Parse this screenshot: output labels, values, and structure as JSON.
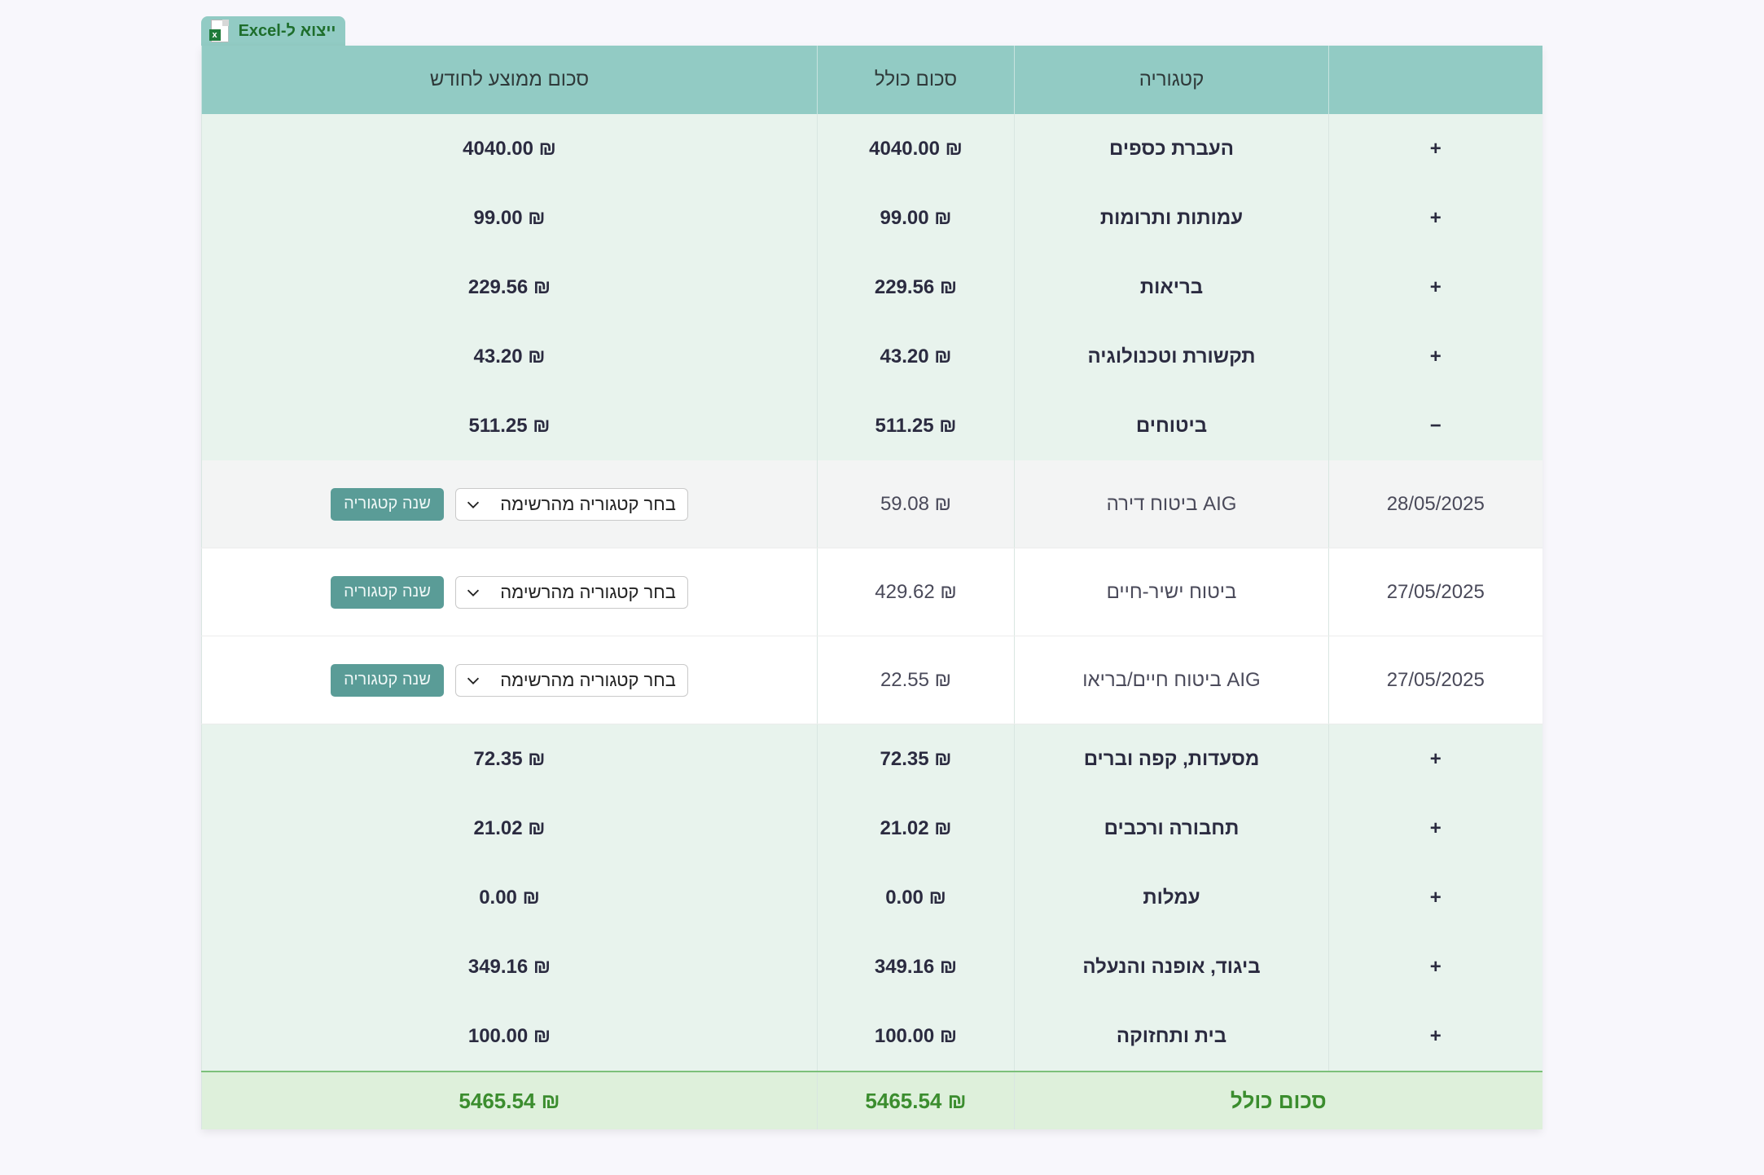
{
  "export": {
    "label": "ייצוא ל-Excel",
    "icon": "excel-file-icon"
  },
  "headers": {
    "expand": "",
    "category": "קטגוריה",
    "total": "סכום כולל",
    "average": "סכום ממוצע לחודש"
  },
  "rows": [
    {
      "type": "category",
      "toggle": "+",
      "category": "העברת כספים",
      "total": "₪ 4040.00",
      "average": "₪ 4040.00"
    },
    {
      "type": "category",
      "toggle": "+",
      "category": "עמותות ותרומות",
      "total": "₪ 99.00",
      "average": "₪ 99.00"
    },
    {
      "type": "category",
      "toggle": "+",
      "category": "בריאות",
      "total": "₪ 229.56",
      "average": "₪ 229.56"
    },
    {
      "type": "category",
      "toggle": "+",
      "category": "תקשורת וטכנולוגיה",
      "total": "₪ 43.20",
      "average": "₪ 43.20"
    },
    {
      "type": "category",
      "toggle": "−",
      "category": "ביטוחים",
      "total": "₪ 511.25",
      "average": "₪ 511.25"
    },
    {
      "type": "transaction",
      "date": "28/05/2025",
      "description": "AIG ביטוח דירה",
      "amount": "₪ 59.08",
      "select_placeholder": "בחר קטגוריה מהרשימה",
      "button": "שנה קטגוריה"
    },
    {
      "type": "transaction",
      "date": "27/05/2025",
      "description": "ביטוח ישיר-חיים",
      "amount": "₪ 429.62",
      "select_placeholder": "בחר קטגוריה מהרשימה",
      "button": "שנה קטגוריה"
    },
    {
      "type": "transaction",
      "date": "27/05/2025",
      "description": "AIG ביטוח חיים/בריאו",
      "amount": "₪ 22.55",
      "select_placeholder": "בחר קטגוריה מהרשימה",
      "button": "שנה קטגוריה"
    },
    {
      "type": "category",
      "toggle": "+",
      "category": "מסעדות, קפה וברים",
      "total": "₪ 72.35",
      "average": "₪ 72.35"
    },
    {
      "type": "category",
      "toggle": "+",
      "category": "תחבורה ורכבים",
      "total": "₪ 21.02",
      "average": "₪ 21.02"
    },
    {
      "type": "category",
      "toggle": "+",
      "category": "עמלות",
      "total": "₪ 0.00",
      "average": "₪ 0.00"
    },
    {
      "type": "category",
      "toggle": "+",
      "category": "ביגוד, אופנה והנעלה",
      "total": "₪ 349.16",
      "average": "₪ 349.16"
    },
    {
      "type": "category",
      "toggle": "+",
      "category": "בית ותחזוקה",
      "total": "₪ 100.00",
      "average": "₪ 100.00"
    }
  ],
  "footer": {
    "label": "סכום כולל",
    "total": "₪ 5465.54",
    "average": "₪ 5465.54"
  }
}
